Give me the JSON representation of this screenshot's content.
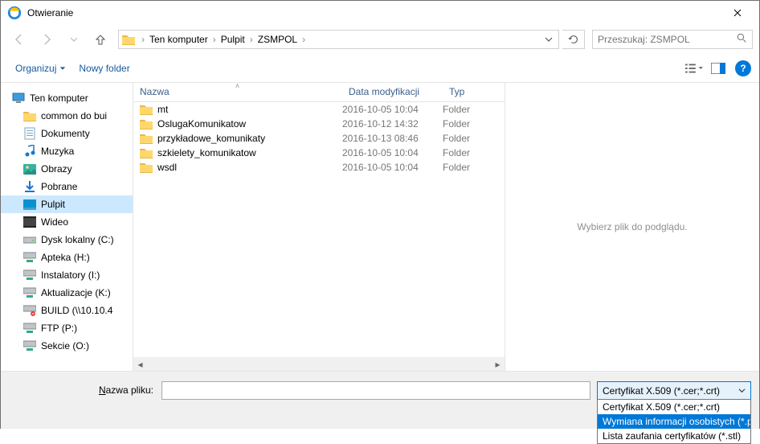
{
  "window": {
    "title": "Otwieranie"
  },
  "breadcrumbs": {
    "root": "Ten komputer",
    "p1": "Pulpit",
    "p2": "ZSMPOL"
  },
  "search": {
    "placeholder": "Przeszukaj: ZSMPOL"
  },
  "toolbar": {
    "organize": "Organizuj",
    "newfolder": "Nowy folder"
  },
  "tree": {
    "root": "Ten komputer",
    "items": [
      {
        "label": "common do bui",
        "icon": "folder"
      },
      {
        "label": "Dokumenty",
        "icon": "docs"
      },
      {
        "label": "Muzyka",
        "icon": "music"
      },
      {
        "label": "Obrazy",
        "icon": "pictures"
      },
      {
        "label": "Pobrane",
        "icon": "downloads"
      },
      {
        "label": "Pulpit",
        "icon": "desktop",
        "selected": true
      },
      {
        "label": "Wideo",
        "icon": "video"
      },
      {
        "label": "Dysk lokalny (C:)",
        "icon": "drive"
      },
      {
        "label": "Apteka (H:)",
        "icon": "netdrive"
      },
      {
        "label": "Instalatory (I:)",
        "icon": "netdrive"
      },
      {
        "label": "Aktualizacje (K:)",
        "icon": "netdrive"
      },
      {
        "label": "BUILD (\\\\10.10.4",
        "icon": "netdrive-err"
      },
      {
        "label": "FTP (P:)",
        "icon": "netdrive"
      },
      {
        "label": "Sekcie (O:)",
        "icon": "netdrive"
      }
    ]
  },
  "columns": {
    "name": "Nazwa",
    "date": "Data modyfikacji",
    "type": "Typ"
  },
  "rows": [
    {
      "name": "mt",
      "date": "2016-10-05 10:04",
      "type": "Folder"
    },
    {
      "name": "OslugaKomunikatow",
      "date": "2016-10-12 14:32",
      "type": "Folder"
    },
    {
      "name": "przykładowe_komunikaty",
      "date": "2016-10-13 08:46",
      "type": "Folder"
    },
    {
      "name": "szkielety_komunikatow",
      "date": "2016-10-05 10:04",
      "type": "Folder"
    },
    {
      "name": "wsdl",
      "date": "2016-10-05 10:04",
      "type": "Folder"
    }
  ],
  "preview": {
    "empty": "Wybierz plik do podglądu."
  },
  "bottom": {
    "filename_label_pre": "",
    "filename_label": "Nazwa pliku:",
    "filename_underline": "N",
    "filename_rest": "azwa pliku:"
  },
  "filter": {
    "selected": "Certyfikat X.509 (*.cer;*.crt)",
    "options": [
      "Certyfikat X.509 (*.cer;*.crt)",
      "Wymiana informacji osobistych (*.pfx;",
      "Lista zaufania certyfikatów (*.stl)"
    ]
  }
}
